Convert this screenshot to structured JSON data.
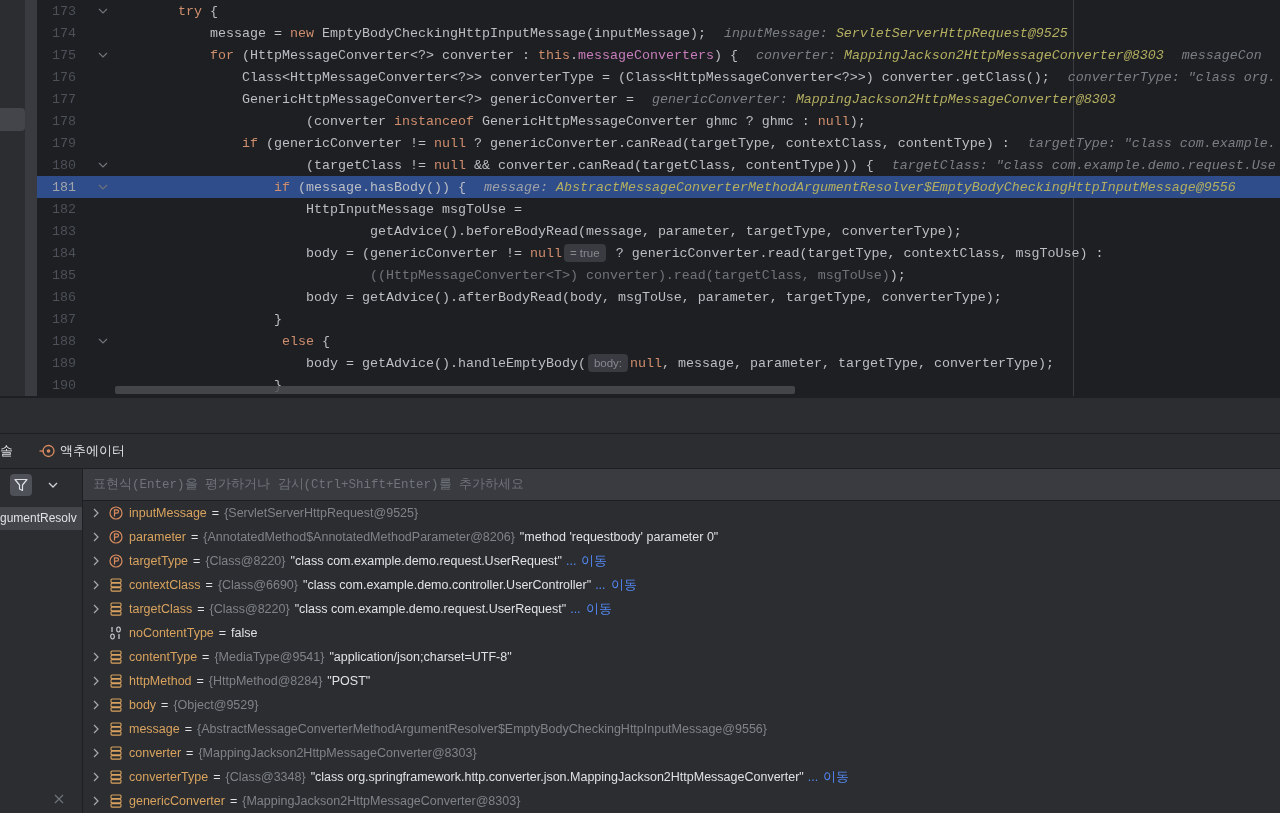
{
  "left_panel": {
    "items": [
      {
        "selected": true
      }
    ]
  },
  "editor": {
    "lines": [
      {
        "number": "173",
        "foldable": true,
        "current": false,
        "parts": [
          {
            "kind": "code",
            "tokens": [
              {
                "kind": "keyword",
                "text": "        try"
              },
              {
                "kind": "plain",
                "text": " {"
              }
            ]
          }
        ]
      },
      {
        "number": "174",
        "foldable": false,
        "current": false,
        "parts": [
          {
            "kind": "code",
            "tokens": [
              {
                "kind": "plain",
                "text": "            message = "
              },
              {
                "kind": "keyword",
                "text": "new"
              },
              {
                "kind": "plain",
                "text": " EmptyBodyCheckingHttpInputMessage(inputMessage);"
              }
            ]
          },
          {
            "kind": "hint",
            "name": "inputMessage:",
            "value": "ServletServerHttpRequest@9525",
            "string": false
          }
        ]
      },
      {
        "number": "175",
        "foldable": true,
        "current": false,
        "parts": [
          {
            "kind": "code",
            "tokens": [
              {
                "kind": "keyword",
                "text": "            for"
              },
              {
                "kind": "plain",
                "text": " (HttpMessageConverter<?> converter : "
              },
              {
                "kind": "keyword",
                "text": "this"
              },
              {
                "kind": "plain",
                "text": "."
              },
              {
                "kind": "field",
                "text": "messageConverters"
              },
              {
                "kind": "plain",
                "text": ") {"
              }
            ]
          },
          {
            "kind": "hint",
            "name": "converter:",
            "value": "MappingJackson2HttpMessageConverter@8303",
            "string": false
          },
          {
            "kind": "hint",
            "name": "messageCon"
          }
        ]
      },
      {
        "number": "176",
        "foldable": false,
        "current": false,
        "parts": [
          {
            "kind": "code",
            "tokens": [
              {
                "kind": "plain",
                "text": "                Class<HttpMessageConverter<?>> converterType = (Class<HttpMessageConverter<?>>) converter.getClass();"
              }
            ]
          },
          {
            "kind": "hint",
            "name": "converterType:",
            "value": "\"class org.",
            "string": true
          }
        ]
      },
      {
        "number": "177",
        "foldable": false,
        "current": false,
        "parts": [
          {
            "kind": "code",
            "tokens": [
              {
                "kind": "plain",
                "text": "                GenericHttpMessageConverter<?> genericConverter ="
              }
            ]
          },
          {
            "kind": "hint",
            "name": "genericConverter:",
            "value": "MappingJackson2HttpMessageConverter@8303",
            "string": false
          }
        ]
      },
      {
        "number": "178",
        "foldable": false,
        "current": false,
        "parts": [
          {
            "kind": "code",
            "tokens": [
              {
                "kind": "plain",
                "text": "                        (converter "
              },
              {
                "kind": "keyword",
                "text": "instanceof"
              },
              {
                "kind": "plain",
                "text": " GenericHttpMessageConverter ghmc ? ghmc : "
              },
              {
                "kind": "keyword",
                "text": "null"
              },
              {
                "kind": "plain",
                "text": ");"
              }
            ]
          }
        ]
      },
      {
        "number": "179",
        "foldable": false,
        "current": false,
        "parts": [
          {
            "kind": "code",
            "tokens": [
              {
                "kind": "keyword",
                "text": "                if"
              },
              {
                "kind": "plain",
                "text": " (genericConverter != "
              },
              {
                "kind": "keyword",
                "text": "null"
              },
              {
                "kind": "plain",
                "text": " ? genericConverter.canRead(targetType, contextClass, contentType) :"
              }
            ]
          },
          {
            "kind": "hint",
            "name": "targetType:",
            "value": "\"class com.example.",
            "string": true
          }
        ]
      },
      {
        "number": "180",
        "foldable": true,
        "current": false,
        "parts": [
          {
            "kind": "code",
            "tokens": [
              {
                "kind": "plain",
                "text": "                        (targetClass != "
              },
              {
                "kind": "keyword",
                "text": "null"
              },
              {
                "kind": "plain",
                "text": " && converter.canRead(targetClass, contentType))) {"
              }
            ]
          },
          {
            "kind": "hint",
            "name": "targetClass:",
            "value": "\"class com.example.demo.request.Use",
            "string": true
          }
        ]
      },
      {
        "number": "181",
        "foldable": true,
        "current": true,
        "parts": [
          {
            "kind": "code",
            "tokens": [
              {
                "kind": "keyword",
                "text": "                    if"
              },
              {
                "kind": "plain",
                "text": " (message.hasBody()) {"
              }
            ]
          },
          {
            "kind": "hint",
            "name": "message:",
            "value": "AbstractMessageConverterMethodArgumentResolver$EmptyBodyCheckingHttpInputMessage@9556",
            "string": false
          }
        ]
      },
      {
        "number": "182",
        "foldable": false,
        "current": false,
        "parts": [
          {
            "kind": "code",
            "tokens": [
              {
                "kind": "plain",
                "text": "                        HttpInputMessage msgToUse ="
              }
            ]
          }
        ]
      },
      {
        "number": "183",
        "foldable": false,
        "current": false,
        "parts": [
          {
            "kind": "code",
            "tokens": [
              {
                "kind": "plain",
                "text": "                                getAdvice().beforeBodyRead(message, parameter, targetType, converterType);"
              }
            ]
          }
        ]
      },
      {
        "number": "184",
        "foldable": false,
        "current": false,
        "parts": [
          {
            "kind": "code",
            "tokens": [
              {
                "kind": "plain",
                "text": "                        body = (genericConverter != "
              },
              {
                "kind": "keyword",
                "text": "null"
              }
            ]
          },
          {
            "kind": "badge",
            "text": "= true"
          },
          {
            "kind": "code",
            "tokens": [
              {
                "kind": "plain",
                "text": " ? genericConverter.read(targetType, contextClass, msgToUse) :"
              }
            ]
          }
        ]
      },
      {
        "number": "185",
        "foldable": false,
        "current": false,
        "parts": [
          {
            "kind": "code",
            "tokens": [
              {
                "kind": "dim",
                "text": "                                ((HttpMessageConverter<T>) converter).read(targetClass, msgToUse)"
              },
              {
                "kind": "plain",
                "text": ");"
              }
            ]
          }
        ]
      },
      {
        "number": "186",
        "foldable": false,
        "current": false,
        "parts": [
          {
            "kind": "code",
            "tokens": [
              {
                "kind": "plain",
                "text": "                        body = getAdvice().afterBodyRead(body, msgToUse, parameter, targetType, converterType);"
              }
            ]
          }
        ]
      },
      {
        "number": "187",
        "foldable": false,
        "current": false,
        "parts": [
          {
            "kind": "code",
            "tokens": [
              {
                "kind": "plain",
                "text": "                    }"
              }
            ]
          }
        ]
      },
      {
        "number": "188",
        "foldable": true,
        "current": false,
        "parts": [
          {
            "kind": "code",
            "tokens": [
              {
                "kind": "keyword",
                "text": "                     else"
              },
              {
                "kind": "plain",
                "text": " {"
              }
            ]
          }
        ]
      },
      {
        "number": "189",
        "foldable": false,
        "current": false,
        "parts": [
          {
            "kind": "code",
            "tokens": [
              {
                "kind": "plain",
                "text": "                        body = getAdvice().handleEmptyBody("
              }
            ]
          },
          {
            "kind": "badge",
            "text": "body:"
          },
          {
            "kind": "code",
            "tokens": [
              {
                "kind": "keyword",
                "text": "null"
              },
              {
                "kind": "plain",
                "text": ", message, parameter, targetType, converterType);"
              }
            ]
          }
        ]
      },
      {
        "number": "190",
        "foldable": false,
        "current": false,
        "parts": [
          {
            "kind": "code",
            "tokens": [
              {
                "kind": "plain",
                "text": "                    }"
              }
            ]
          }
        ]
      }
    ]
  },
  "debug_panel": {
    "tabs": [
      {
        "label": "솔"
      },
      {
        "label": "액추에이터"
      }
    ],
    "filter_button": {
      "on": true
    },
    "expression_field": {
      "placeholder": "표현식(Enter)을 평가하거나 감시(Ctrl+Shift+Enter)를 추가하세요"
    },
    "frames": [
      {
        "label": "gumentResolv",
        "selected": true
      }
    ],
    "variables": [
      {
        "kind": "param",
        "expandable": true,
        "name": "inputMessage",
        "sign": "=",
        "type": "{ServletServerHttpRequest@9525}"
      },
      {
        "kind": "param",
        "expandable": true,
        "name": "parameter",
        "sign": "=",
        "type": "{AnnotatedMethod$AnnotatedMethodParameter@8206}",
        "value": "\"method 'requestbody' parameter 0\""
      },
      {
        "kind": "param",
        "expandable": true,
        "name": "targetType",
        "sign": "=",
        "type": "{Class@8220}",
        "value": "\"class com.example.demo.request.UserRequest\"",
        "more": "...",
        "link": "이동"
      },
      {
        "kind": "field",
        "expandable": true,
        "name": "contextClass",
        "sign": "=",
        "type": "{Class@6690}",
        "value": "\"class com.example.demo.controller.UserController\"",
        "more": "...",
        "link": "이동"
      },
      {
        "kind": "field",
        "expandable": true,
        "name": "targetClass",
        "sign": "=",
        "type": "{Class@8220}",
        "value": "\"class com.example.demo.request.UserRequest\"",
        "more": "...",
        "link": "이동"
      },
      {
        "kind": "primitive",
        "expandable": false,
        "name": "noContentType",
        "sign": "=",
        "value": "false"
      },
      {
        "kind": "field",
        "expandable": true,
        "name": "contentType",
        "sign": "=",
        "type": "{MediaType@9541}",
        "value": "\"application/json;charset=UTF-8\""
      },
      {
        "kind": "field",
        "expandable": true,
        "name": "httpMethod",
        "sign": "=",
        "type": "{HttpMethod@8284}",
        "value": "\"POST\""
      },
      {
        "kind": "field",
        "expandable": true,
        "name": "body",
        "sign": "=",
        "type": "{Object@9529}"
      },
      {
        "kind": "field",
        "expandable": true,
        "name": "message",
        "sign": "=",
        "type": "{AbstractMessageConverterMethodArgumentResolver$EmptyBodyCheckingHttpInputMessage@9556}"
      },
      {
        "kind": "field",
        "expandable": true,
        "name": "converter",
        "sign": "=",
        "type": "{MappingJackson2HttpMessageConverter@8303}"
      },
      {
        "kind": "field",
        "expandable": true,
        "name": "converterType",
        "sign": "=",
        "type": "{Class@3348}",
        "value": "\"class org.springframework.http.converter.json.MappingJackson2HttpMessageConverter\"",
        "more": "...",
        "link": "이동"
      },
      {
        "kind": "field",
        "expandable": true,
        "name": "genericConverter",
        "sign": "=",
        "type": "{MappingJackson2HttpMessageConverter@8303}"
      }
    ]
  }
}
